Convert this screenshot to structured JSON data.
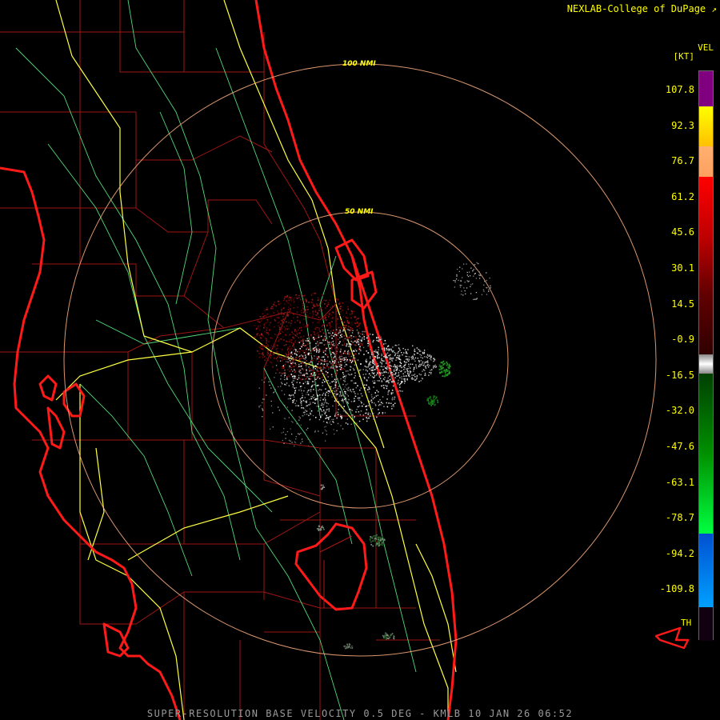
{
  "credit": "NEXLAB-College of DuPage",
  "footer": "SUPER-RESOLUTION BASE VELOCITY 0.5 DEG - KMLB 10 JAN 26 06:52",
  "legend": {
    "title_line1": "VEL",
    "title_line2": "[KT]",
    "bottom_label": "TH",
    "ticks": [
      "107.8",
      "92.3",
      "76.7",
      "61.2",
      "45.6",
      "30.1",
      "14.5",
      "-0.9",
      "-16.5",
      "-32.0",
      "-47.6",
      "-63.1",
      "-78.7",
      "-94.2",
      "-109.8"
    ]
  },
  "rings": [
    {
      "label": "100 NMI"
    },
    {
      "label": "50 NMI"
    }
  ],
  "colors": {
    "coast": "#ff1a1a",
    "county": "#b01818",
    "roads": "#ffff40",
    "rivers": "#60ff90",
    "rings": "#ffb080",
    "legend_scale": [
      "#800080",
      "#ffff00",
      "#ffa060",
      "#ff0000",
      "#600000",
      "#ffffff",
      "#009000",
      "#00ff40",
      "#0050ff",
      "#00a0ff",
      "#100010"
    ]
  }
}
